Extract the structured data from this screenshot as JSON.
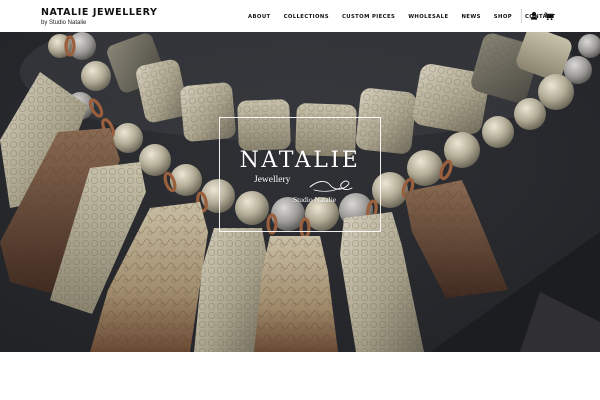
{
  "header": {
    "brand": "NATALIE JEWELLERY",
    "tagline": "by Studio Natalie",
    "nav": [
      "ABOUT",
      "COLLECTIONS",
      "CUSTOM PIECES",
      "WHOLESALE",
      "NEWS",
      "SHOP",
      "CONTACT"
    ],
    "icons": [
      "user-icon",
      "cart-icon"
    ]
  },
  "hero": {
    "logo_title": "NATALIE",
    "logo_subtitle": "Jewellery",
    "logo_studio": "Studio Natalie",
    "image_subject": "fossil coral bead necklace with etched copper pendants on dark display",
    "colors": {
      "background": "#2b2c30",
      "stone": "#b5ad97",
      "copper": "#9a6a47"
    }
  }
}
